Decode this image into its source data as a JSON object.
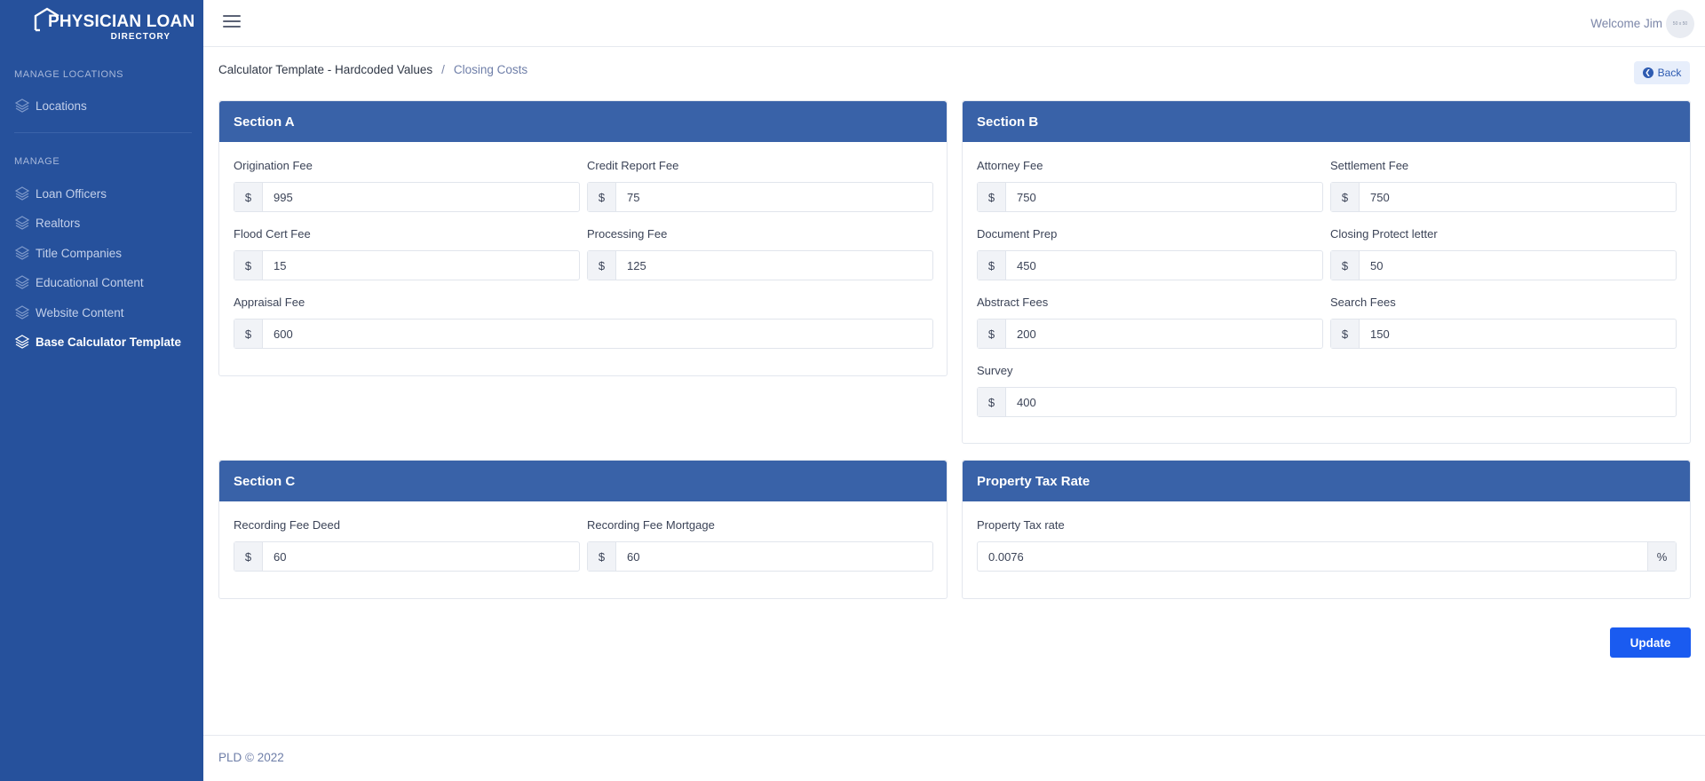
{
  "brand": {
    "line1": "PHYSICIAN LOAN",
    "line2": "DIRECTORY"
  },
  "sidebar": {
    "sections": [
      {
        "label": "MANAGE LOCATIONS",
        "items": [
          {
            "label": "Locations"
          }
        ]
      },
      {
        "label": "MANAGE",
        "items": [
          {
            "label": "Loan Officers"
          },
          {
            "label": "Realtors"
          },
          {
            "label": "Title Companies"
          },
          {
            "label": "Educational Content"
          },
          {
            "label": "Website Content"
          },
          {
            "label": "Base Calculator Template",
            "active": true
          }
        ]
      }
    ]
  },
  "topbar": {
    "welcome": "Welcome Jim",
    "avatar_text": "50 x 50"
  },
  "breadcrumb": {
    "parent": "Calculator Template - Hardcoded Values",
    "separator": "/",
    "current": "Closing Costs"
  },
  "back_label": "Back",
  "sections": {
    "a": {
      "title": "Section A",
      "fields": [
        {
          "label": "Origination Fee",
          "prefix": "$",
          "value": "995"
        },
        {
          "label": "Credit Report Fee",
          "prefix": "$",
          "value": "75"
        },
        {
          "label": "Flood Cert Fee",
          "prefix": "$",
          "value": "15"
        },
        {
          "label": "Processing Fee",
          "prefix": "$",
          "value": "125"
        },
        {
          "label": "Appraisal Fee",
          "prefix": "$",
          "value": "600"
        }
      ]
    },
    "b": {
      "title": "Section B",
      "fields": [
        {
          "label": "Attorney Fee",
          "prefix": "$",
          "value": "750"
        },
        {
          "label": "Settlement Fee",
          "prefix": "$",
          "value": "750"
        },
        {
          "label": "Document Prep",
          "prefix": "$",
          "value": "450"
        },
        {
          "label": "Closing Protect letter",
          "prefix": "$",
          "value": "50"
        },
        {
          "label": "Abstract Fees",
          "prefix": "$",
          "value": "200"
        },
        {
          "label": "Search Fees",
          "prefix": "$",
          "value": "150"
        },
        {
          "label": "Survey",
          "prefix": "$",
          "value": "400"
        }
      ]
    },
    "c": {
      "title": "Section C",
      "fields": [
        {
          "label": "Recording Fee Deed",
          "prefix": "$",
          "value": "60"
        },
        {
          "label": "Recording Fee Mortgage",
          "prefix": "$",
          "value": "60"
        }
      ]
    },
    "tax": {
      "title": "Property Tax Rate",
      "fields": [
        {
          "label": "Property Tax rate",
          "suffix": "%",
          "value": "0.0076"
        }
      ]
    }
  },
  "update_label": "Update",
  "footer": {
    "text": "PLD © 2022"
  },
  "colors": {
    "sidebar": "#26519c",
    "card_header": "#3962a8",
    "primary_button": "#1a5bf0"
  }
}
